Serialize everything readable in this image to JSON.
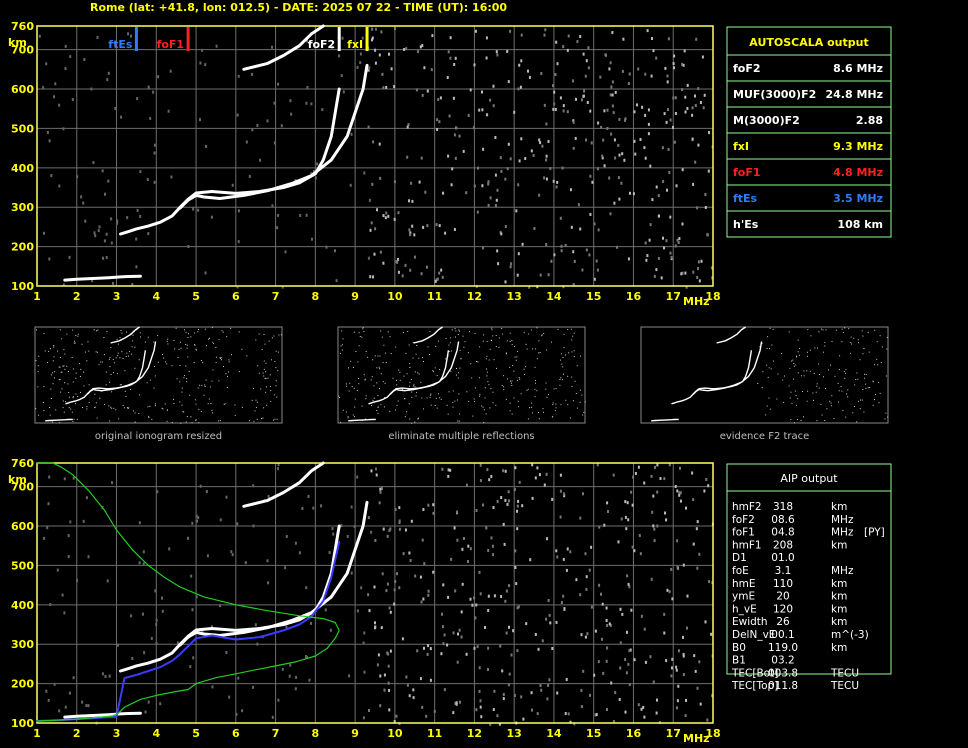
{
  "header": {
    "title": "Rome (lat: +41.8, lon: 012.5) - DATE: 2025 07 22 - TIME (UT): 16:00"
  },
  "colors": {
    "axis": "#ffff66",
    "grid": "#6e6e6e",
    "fxl": "#ffff00",
    "fof1": "#ff2020",
    "ftes": "#2e7dff",
    "fof2": "#ffffff",
    "profile": "#22cc22",
    "aip_trace": "#3a3aff",
    "tbl_border": "#8cff8c"
  },
  "autoscala": {
    "title": "AUTOSCALA output",
    "rows": [
      {
        "label": "foF2",
        "value": "8.6 MHz",
        "color": "#ffffff"
      },
      {
        "label": "MUF(3000)F2",
        "value": "24.8 MHz",
        "color": "#ffffff"
      },
      {
        "label": "M(3000)F2",
        "value": "2.88",
        "color": "#ffffff"
      },
      {
        "label": "fxI",
        "value": "9.3 MHz",
        "color": "#ffff00"
      },
      {
        "label": "foF1",
        "value": "4.8 MHz",
        "color": "#ff2020"
      },
      {
        "label": "ftEs",
        "value": "3.5 MHz",
        "color": "#2e7dff"
      },
      {
        "label": "h'Es",
        "value": "108   km",
        "color": "#ffffff"
      }
    ]
  },
  "aip": {
    "title": "AIP output",
    "rows": [
      {
        "name": "hmF2",
        "value": "318",
        "unit": "km",
        "note": ""
      },
      {
        "name": "foF2",
        "value": "08.6",
        "unit": "MHz",
        "note": ""
      },
      {
        "name": "foF1",
        "value": "04.8",
        "unit": "MHz",
        "note": "[PY]"
      },
      {
        "name": "hmF1",
        "value": "208",
        "unit": "km",
        "note": ""
      },
      {
        "name": "D1",
        "value": "01.0",
        "unit": "",
        "note": ""
      },
      {
        "name": "foE",
        "value": "3.1",
        "unit": "MHz",
        "note": ""
      },
      {
        "name": "hmE",
        "value": "110",
        "unit": "km",
        "note": ""
      },
      {
        "name": "ymE",
        "value": "20",
        "unit": "km",
        "note": ""
      },
      {
        "name": "h_vE",
        "value": "120",
        "unit": "km",
        "note": ""
      },
      {
        "name": "Ewidth",
        "value": "26",
        "unit": "km",
        "note": ""
      },
      {
        "name": "DelN_vE",
        "value": "00.1",
        "unit": "m^(-3)",
        "note": ""
      },
      {
        "name": "B0",
        "value": "119.0",
        "unit": "km",
        "note": ""
      },
      {
        "name": "B1",
        "value": "03.2",
        "unit": "",
        "note": ""
      },
      {
        "name": "TEC[Bot]",
        "value": "003.8",
        "unit": "TECU",
        "note": ""
      },
      {
        "name": "TEC[Top]",
        "value": "011.8",
        "unit": "TECU",
        "note": ""
      }
    ]
  },
  "thumbnails": {
    "captions": [
      "original ionogram resized",
      "eliminate multiple reflections",
      "evidence F2 trace"
    ]
  },
  "chart_data": [
    {
      "type": "scatter",
      "title": "",
      "xlabel": "MHz",
      "ylabel": "km",
      "xlim": [
        1,
        18
      ],
      "ylim": [
        100,
        760
      ],
      "x_ticks": [
        1,
        2,
        3,
        4,
        5,
        6,
        7,
        8,
        9,
        10,
        11,
        12,
        13,
        14,
        15,
        16,
        17,
        18
      ],
      "y_ticks": [
        760,
        700,
        600,
        500,
        400,
        300,
        200,
        100
      ],
      "grid": true,
      "markers": [
        {
          "label": "ftEs",
          "freq": 3.5,
          "color": "#2e7dff"
        },
        {
          "label": "foF1",
          "freq": 4.8,
          "color": "#ff2020"
        },
        {
          "label": "foF2",
          "freq": 8.6,
          "color": "#ffffff"
        },
        {
          "label": "fxI",
          "freq": 9.3,
          "color": "#ffff00"
        }
      ],
      "series": [
        {
          "x": [
            1.7,
            2.0,
            2.4,
            2.8,
            3.1,
            3.3,
            3.6
          ],
          "y": [
            115,
            117,
            119,
            121,
            123,
            124,
            125
          ]
        },
        {
          "x": [
            3.1,
            3.3,
            3.5,
            3.8,
            4.1,
            4.4,
            4.6,
            4.8,
            5.0,
            5.4,
            6.0,
            6.6,
            7.2,
            7.6,
            8.0,
            8.2,
            8.4,
            8.5,
            8.6
          ],
          "y": [
            232,
            238,
            245,
            252,
            262,
            278,
            300,
            320,
            336,
            340,
            335,
            340,
            350,
            362,
            385,
            420,
            480,
            540,
            600
          ]
        },
        {
          "x": [
            4.6,
            4.8,
            5.0,
            5.2,
            5.6,
            6.2,
            6.8,
            7.4,
            7.9,
            8.4,
            8.8,
            9.0,
            9.2,
            9.3
          ],
          "y": [
            298,
            318,
            330,
            326,
            322,
            330,
            342,
            360,
            380,
            420,
            480,
            540,
            600,
            660
          ]
        },
        {
          "x": [
            6.2,
            6.8,
            7.2,
            7.6,
            7.9,
            8.2
          ],
          "y": [
            650,
            665,
            685,
            710,
            740,
            760
          ]
        }
      ]
    },
    {
      "type": "scatter",
      "title": "",
      "xlabel": "MHz",
      "ylabel": "km",
      "xlim": [
        1,
        18
      ],
      "ylim": [
        100,
        760
      ],
      "x_ticks": [
        1,
        2,
        3,
        4,
        5,
        6,
        7,
        8,
        9,
        10,
        11,
        12,
        13,
        14,
        15,
        16,
        17,
        18
      ],
      "y_ticks": [
        760,
        700,
        600,
        500,
        400,
        300,
        200,
        100
      ],
      "grid": true,
      "series": [
        {
          "x": [
            1.7,
            2.0,
            2.4,
            2.8,
            3.1,
            3.3,
            3.6
          ],
          "y": [
            115,
            117,
            119,
            121,
            123,
            124,
            125
          ]
        },
        {
          "x": [
            3.1,
            3.3,
            3.5,
            3.8,
            4.1,
            4.4,
            4.6,
            4.8,
            5.0,
            5.4,
            6.0,
            6.6,
            7.2,
            7.6,
            8.0,
            8.2,
            8.4,
            8.5,
            8.6
          ],
          "y": [
            232,
            238,
            245,
            252,
            262,
            278,
            300,
            320,
            336,
            340,
            335,
            340,
            350,
            362,
            385,
            420,
            480,
            540,
            600
          ]
        },
        {
          "x": [
            4.6,
            4.8,
            5.0,
            5.2,
            5.6,
            6.2,
            6.8,
            7.4,
            7.9,
            8.4,
            8.8,
            9.0,
            9.2,
            9.3
          ],
          "y": [
            298,
            318,
            330,
            326,
            322,
            330,
            342,
            360,
            380,
            420,
            480,
            540,
            600,
            660
          ]
        },
        {
          "x": [
            6.2,
            6.8,
            7.2,
            7.6,
            7.9,
            8.2
          ],
          "y": [
            650,
            665,
            685,
            710,
            740,
            760
          ]
        },
        {
          "x": [
            1.0,
            1.5,
            2.0,
            2.5,
            3.0,
            3.2,
            3.5,
            3.8,
            4.1,
            4.4,
            4.6,
            4.8,
            5.0,
            5.4,
            6.0,
            6.6,
            7.2,
            7.6,
            7.9,
            8.2,
            8.4,
            8.6
          ],
          "y": [
            105,
            107,
            110,
            113,
            116,
            214,
            222,
            232,
            242,
            258,
            275,
            295,
            315,
            322,
            312,
            318,
            335,
            350,
            370,
            410,
            470,
            560
          ],
          "color": "#3a3aff"
        },
        {
          "x": [
            1.0,
            1.5,
            2.0,
            2.6,
            2.9,
            3.05,
            3.2,
            3.6,
            4.0,
            4.5,
            4.8,
            5.0,
            5.5,
            6.0,
            6.5,
            7.0,
            7.5,
            8.0,
            8.3,
            8.5,
            8.6,
            8.5,
            8.2,
            7.6,
            6.8,
            6.0,
            5.2,
            4.6,
            4.2,
            3.8,
            3.4,
            3.0,
            2.7,
            2.3,
            1.9,
            1.6,
            1.4,
            1.2,
            1.0
          ],
          "y": [
            105,
            107,
            110,
            115,
            118,
            125,
            140,
            160,
            170,
            180,
            185,
            200,
            215,
            225,
            235,
            245,
            255,
            270,
            290,
            315,
            335,
            355,
            365,
            372,
            385,
            400,
            420,
            445,
            470,
            500,
            540,
            590,
            640,
            690,
            730,
            750,
            760,
            760,
            760
          ],
          "color": "#22cc22"
        }
      ]
    }
  ]
}
